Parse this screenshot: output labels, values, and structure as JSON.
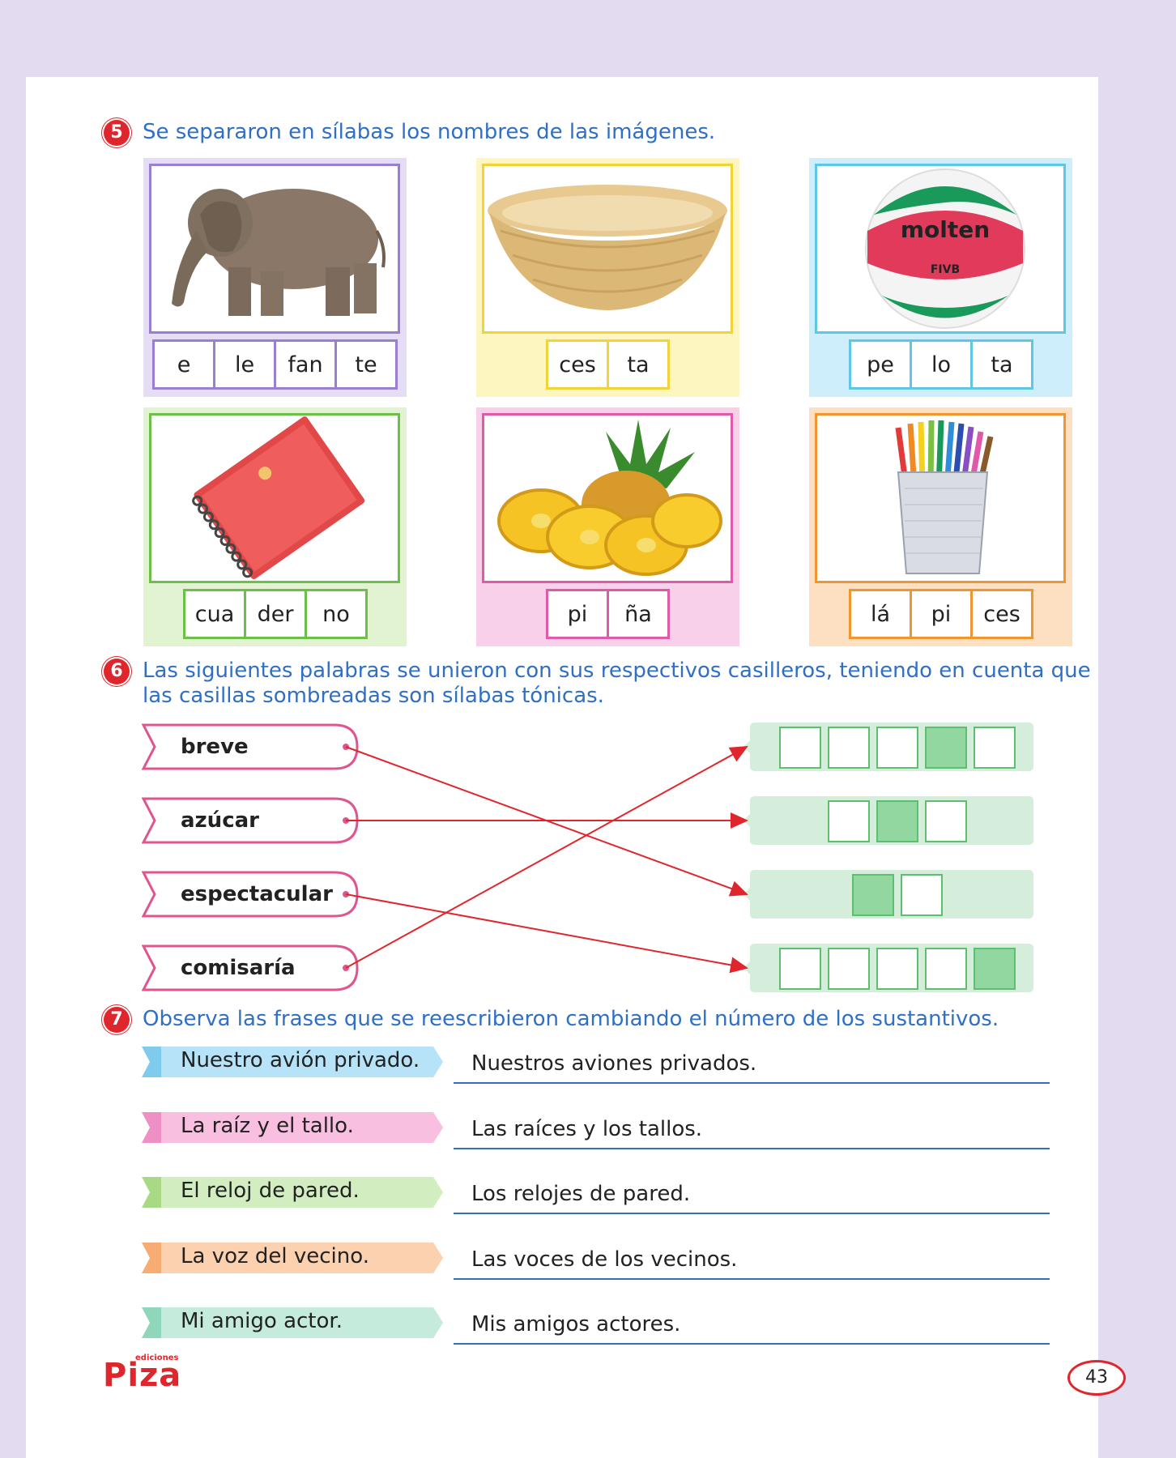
{
  "q5": {
    "number": "5",
    "instruction": "Se separaron en sílabas los nombres de las imágenes.",
    "items": [
      {
        "image": "elephant",
        "syllables": [
          "e",
          "le",
          "fan",
          "te"
        ],
        "color": "#9a7fd1",
        "bg": "#e5dcf5"
      },
      {
        "image": "basket",
        "syllables": [
          "ces",
          "ta"
        ],
        "color": "#f2d33a",
        "bg": "#fdf6c0"
      },
      {
        "image": "volleyball",
        "syllables": [
          "pe",
          "lo",
          "ta"
        ],
        "color": "#5fc7e6",
        "bg": "#cdeefa"
      },
      {
        "image": "notebook",
        "syllables": [
          "cua",
          "der",
          "no"
        ],
        "color": "#6cc04a",
        "bg": "#e2f3d2"
      },
      {
        "image": "pineapple",
        "syllables": [
          "pi",
          "ña"
        ],
        "color": "#e05aaa",
        "bg": "#f9d0ea"
      },
      {
        "image": "pencils",
        "syllables": [
          "lá",
          "pi",
          "ces"
        ],
        "color": "#f0962e",
        "bg": "#fde0c2"
      }
    ],
    "ball_text": {
      "brand": "molten",
      "mark": "FIVB"
    }
  },
  "q6": {
    "number": "6",
    "instruction_line1": "Las siguientes palabras se unieron con sus respectivos casilleros, teniendo en cuenta que",
    "instruction_line2": "las casillas sombreadas son sílabas tónicas.",
    "words": [
      "breve",
      "azúcar",
      "espectacular",
      "comisaría"
    ],
    "box_groups": [
      {
        "count": 5,
        "shaded_index": 3
      },
      {
        "count": 3,
        "shaded_index": 1
      },
      {
        "count": 2,
        "shaded_index": 0
      },
      {
        "count": 5,
        "shaded_index": 4
      }
    ],
    "connections": [
      [
        0,
        2
      ],
      [
        1,
        1
      ],
      [
        2,
        3
      ],
      [
        3,
        0
      ]
    ],
    "colors": {
      "tag": "#e0558f",
      "box_bg": "#d4eedb",
      "line": "#e0262d"
    }
  },
  "q7": {
    "number": "7",
    "instruction": "Observa las frases que se reescribieron cambiando el número de los sustantivos.",
    "rows": [
      {
        "phrase": "Nuestro avión privado.",
        "answer": "Nuestros aviones privados.",
        "color": "#b6e3f7",
        "accent": "#7fcbee"
      },
      {
        "phrase": "La raíz y el tallo.",
        "answer": "Las raíces y los tallos.",
        "color": "#f8bfe0",
        "accent": "#ee8fc6"
      },
      {
        "phrase": "El reloj de pared.",
        "answer": "Los relojes de pared.",
        "color": "#d2eec0",
        "accent": "#a8da86"
      },
      {
        "phrase": "La voz del vecino.",
        "answer": "Las voces de los vecinos.",
        "color": "#fbd1b0",
        "accent": "#f6ac72"
      },
      {
        "phrase": "Mi amigo actor.",
        "answer": "Mis amigos actores.",
        "color": "#c4ebdc",
        "accent": "#8fd6bb"
      }
    ]
  },
  "footer": {
    "logo": "Piza",
    "logo_small": "ediciones",
    "page_number": "43"
  }
}
